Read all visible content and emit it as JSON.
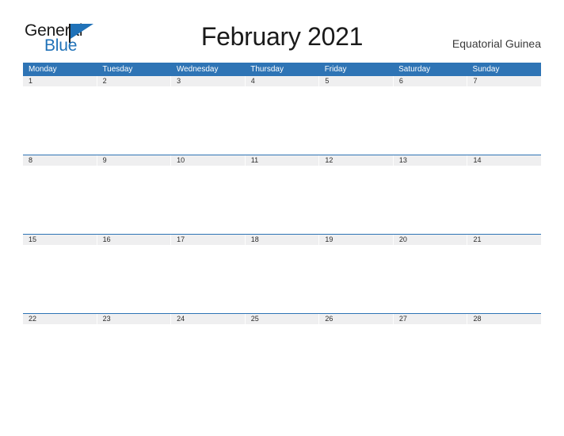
{
  "brand": {
    "name_part1": "General",
    "name_part2": "Blue",
    "color_dark": "#1a1a1a",
    "color_blue": "#2072b8"
  },
  "header": {
    "title": "February 2021",
    "subtitle": "Equatorial Guinea"
  },
  "calendar": {
    "accent_color": "#2e74b5",
    "daynum_band_color": "#efeff0",
    "weekdays": [
      "Monday",
      "Tuesday",
      "Wednesday",
      "Thursday",
      "Friday",
      "Saturday",
      "Sunday"
    ],
    "weeks": [
      {
        "days": [
          {
            "number": "1",
            "events": ""
          },
          {
            "number": "2",
            "events": ""
          },
          {
            "number": "3",
            "events": ""
          },
          {
            "number": "4",
            "events": ""
          },
          {
            "number": "5",
            "events": ""
          },
          {
            "number": "6",
            "events": ""
          },
          {
            "number": "7",
            "events": ""
          }
        ]
      },
      {
        "days": [
          {
            "number": "8",
            "events": ""
          },
          {
            "number": "9",
            "events": ""
          },
          {
            "number": "10",
            "events": ""
          },
          {
            "number": "11",
            "events": ""
          },
          {
            "number": "12",
            "events": ""
          },
          {
            "number": "13",
            "events": ""
          },
          {
            "number": "14",
            "events": ""
          }
        ]
      },
      {
        "days": [
          {
            "number": "15",
            "events": ""
          },
          {
            "number": "16",
            "events": ""
          },
          {
            "number": "17",
            "events": ""
          },
          {
            "number": "18",
            "events": ""
          },
          {
            "number": "19",
            "events": ""
          },
          {
            "number": "20",
            "events": ""
          },
          {
            "number": "21",
            "events": ""
          }
        ]
      },
      {
        "days": [
          {
            "number": "22",
            "events": ""
          },
          {
            "number": "23",
            "events": ""
          },
          {
            "number": "24",
            "events": ""
          },
          {
            "number": "25",
            "events": ""
          },
          {
            "number": "26",
            "events": ""
          },
          {
            "number": "27",
            "events": ""
          },
          {
            "number": "28",
            "events": ""
          }
        ]
      }
    ]
  }
}
